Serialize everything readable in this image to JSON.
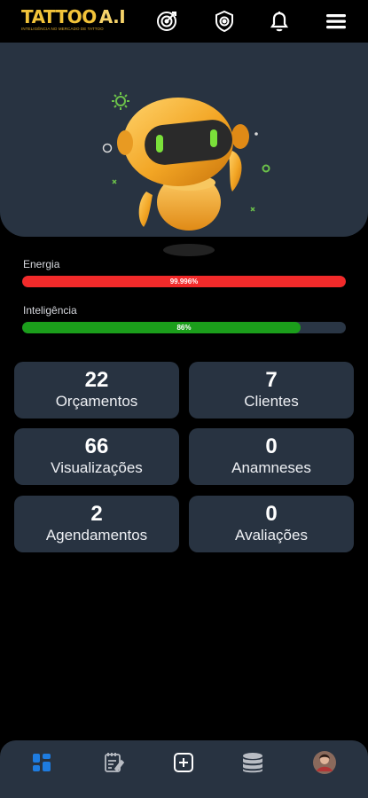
{
  "header": {
    "logo_main": "TATTOO",
    "logo_ai": "A.I",
    "logo_tagline": "INTELIGÊNCIA NO MERCADO DE TATTOO",
    "icons": [
      "target-icon",
      "badge-icon",
      "bell-icon",
      "menu-icon"
    ]
  },
  "hero": {
    "image": "robot-mascot"
  },
  "stats_bars": {
    "energy": {
      "label": "Energia",
      "value_text": "99.996%",
      "fraction": 0.99996,
      "color": "#f22a2a"
    },
    "intelligence": {
      "label": "Inteligência",
      "value_text": "86%",
      "fraction": 0.86,
      "color": "#1b9e1b"
    }
  },
  "cards": [
    {
      "value": "22",
      "label": "Orçamentos"
    },
    {
      "value": "7",
      "label": "Clientes"
    },
    {
      "value": "66",
      "label": "Visualizações"
    },
    {
      "value": "0",
      "label": "Anamneses"
    },
    {
      "value": "2",
      "label": "Agendamentos"
    },
    {
      "value": "0",
      "label": "Avaliações"
    }
  ],
  "bottom_nav": {
    "items": [
      "dashboard-icon",
      "notes-icon",
      "add-icon",
      "coins-icon",
      "profile-avatar"
    ],
    "active": "dashboard-icon",
    "accent": "#1e7ce0"
  }
}
